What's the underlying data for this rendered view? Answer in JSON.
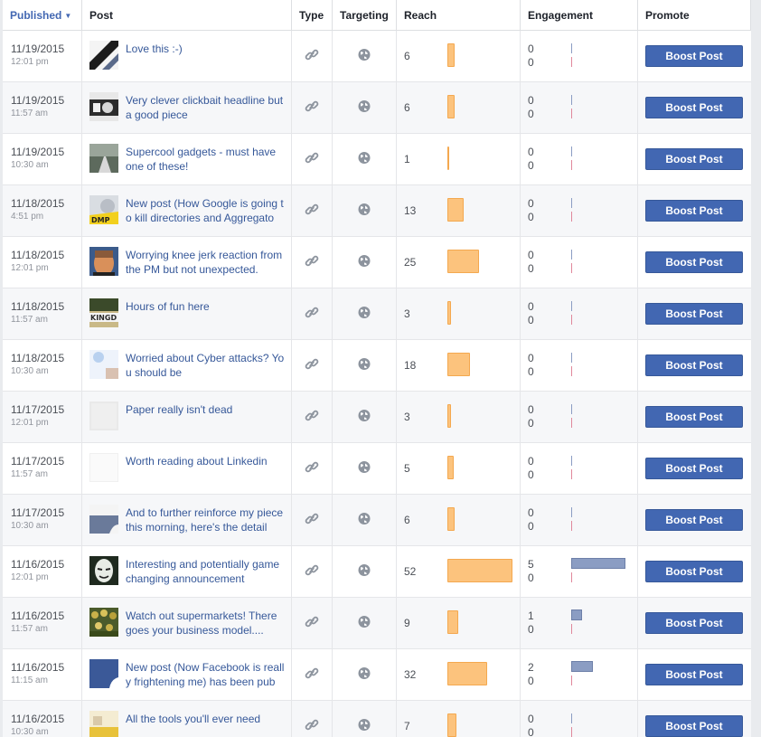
{
  "headers": {
    "published": "Published",
    "post": "Post",
    "type": "Type",
    "targeting": "Targeting",
    "reach": "Reach",
    "engagement": "Engagement",
    "promote": "Promote"
  },
  "sort_indicator": "▼",
  "reach_scale_max": 52,
  "engagement_scale_max": 5,
  "rows": [
    {
      "date": "11/19/2015",
      "time": "12:01 pm",
      "text": "Love this :-)",
      "thumb": "thumb-stripe",
      "type_icon": "link-icon",
      "targeting_icon": "globe-icon",
      "reach": 6,
      "eng1": 0,
      "eng2": 0,
      "button": "Boost Post"
    },
    {
      "date": "11/19/2015",
      "time": "11:57 am",
      "text": "Very clever clickbait headline but a good piece",
      "thumb": "thumb-dark",
      "type_icon": "link-icon",
      "targeting_icon": "globe-icon",
      "reach": 6,
      "eng1": 0,
      "eng2": 0,
      "button": "Boost Post"
    },
    {
      "date": "11/19/2015",
      "time": "10:30 am",
      "text": "Supercool gadgets - must have one of these!",
      "thumb": "thumb-road",
      "type_icon": "link-icon",
      "targeting_icon": "globe-icon",
      "reach": 1,
      "eng1": 0,
      "eng2": 0,
      "button": "Boost Post"
    },
    {
      "date": "11/18/2015",
      "time": "4:51 pm",
      "text": "New post (How Google is going to kill directories and Aggregato",
      "thumb": "thumb-dmp",
      "type_icon": "link-icon",
      "targeting_icon": "globe-icon",
      "reach": 13,
      "eng1": 0,
      "eng2": 0,
      "button": "Boost Post"
    },
    {
      "date": "11/18/2015",
      "time": "12:01 pm",
      "text": "Worrying knee jerk reaction from the PM but not unexpected.",
      "thumb": "thumb-face",
      "type_icon": "link-icon",
      "targeting_icon": "globe-icon",
      "reach": 25,
      "eng1": 0,
      "eng2": 0,
      "button": "Boost Post"
    },
    {
      "date": "11/18/2015",
      "time": "11:57 am",
      "text": "Hours of fun here",
      "thumb": "thumb-kingd",
      "type_icon": "link-icon",
      "targeting_icon": "globe-icon",
      "reach": 3,
      "eng1": 0,
      "eng2": 0,
      "button": "Boost Post"
    },
    {
      "date": "11/18/2015",
      "time": "10:30 am",
      "text": "Worried about Cyber attacks? You should be",
      "thumb": "thumb-cyber",
      "type_icon": "link-icon",
      "targeting_icon": "globe-icon",
      "reach": 18,
      "eng1": 0,
      "eng2": 0,
      "button": "Boost Post"
    },
    {
      "date": "11/17/2015",
      "time": "12:01 pm",
      "text": "Paper really isn't dead",
      "thumb": "thumb-blank",
      "type_icon": "link-icon",
      "targeting_icon": "globe-icon",
      "reach": 3,
      "eng1": 0,
      "eng2": 0,
      "button": "Boost Post"
    },
    {
      "date": "11/17/2015",
      "time": "11:57 am",
      "text": "Worth reading about Linkedin",
      "thumb": "thumb-white",
      "type_icon": "link-icon",
      "targeting_icon": "globe-icon",
      "reach": 5,
      "eng1": 0,
      "eng2": 0,
      "button": "Boost Post"
    },
    {
      "date": "11/17/2015",
      "time": "10:30 am",
      "text": "And to further reinforce my piece this morning, here's the detail",
      "thumb": "thumb-fold",
      "type_icon": "link-icon",
      "targeting_icon": "globe-icon",
      "reach": 6,
      "eng1": 0,
      "eng2": 0,
      "button": "Boost Post"
    },
    {
      "date": "11/16/2015",
      "time": "12:01 pm",
      "text": "Interesting and potentially game changing announcement",
      "thumb": "thumb-mask",
      "type_icon": "link-icon",
      "targeting_icon": "globe-icon",
      "reach": 52,
      "eng1": 5,
      "eng2": 0,
      "button": "Boost Post"
    },
    {
      "date": "11/16/2015",
      "time": "11:57 am",
      "text": "Watch out supermarkets! There goes your business model....",
      "thumb": "thumb-crowd",
      "type_icon": "link-icon",
      "targeting_icon": "globe-icon",
      "reach": 9,
      "eng1": 1,
      "eng2": 0,
      "button": "Boost Post"
    },
    {
      "date": "11/16/2015",
      "time": "11:15 am",
      "text": "New post (Now Facebook is really frightening me) has been pub",
      "thumb": "thumb-fb",
      "type_icon": "link-icon",
      "targeting_icon": "globe-icon",
      "reach": 32,
      "eng1": 2,
      "eng2": 0,
      "button": "Boost Post"
    },
    {
      "date": "11/16/2015",
      "time": "10:30 am",
      "text": "All the tools you'll ever need",
      "thumb": "thumb-tools",
      "type_icon": "link-icon",
      "targeting_icon": "globe-icon",
      "reach": 7,
      "eng1": 0,
      "eng2": 0,
      "button": "Boost Post"
    }
  ]
}
